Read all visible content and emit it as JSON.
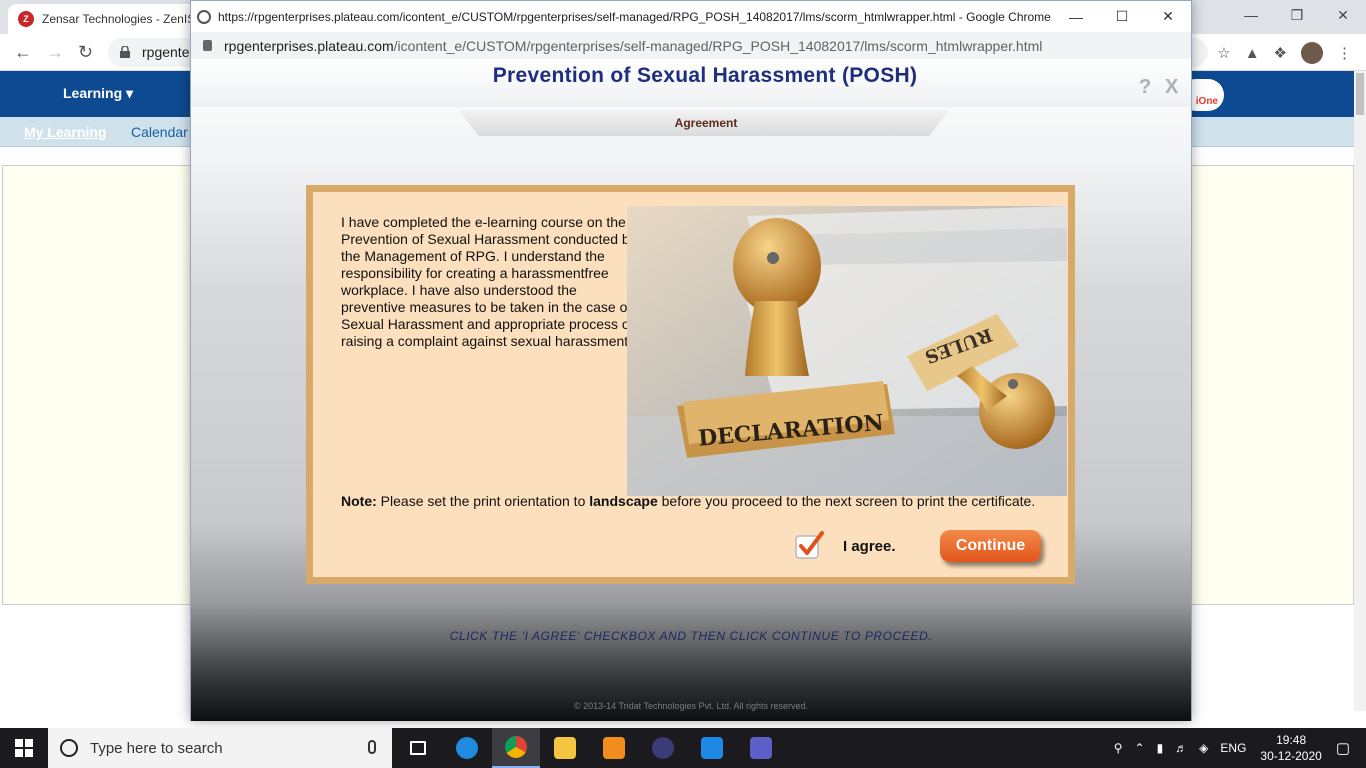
{
  "browser": {
    "tab_title": "Zensar Technologies - ZenIS",
    "tab_favicon_text": "Z",
    "address_partial": "rpgente",
    "learning_menu": "Learning",
    "logo_text": "iOne",
    "subnav": {
      "my_learning": "My Learning",
      "calendar": "Calendar"
    }
  },
  "popup": {
    "title": "https://rpgenterprises.plateau.com/icontent_e/CUSTOM/rpgenterprises/self-managed/RPG_POSH_14082017/lms/scorm_htmlwrapper.html - Google Chrome",
    "url_domain": "rpgenterprises.plateau.com",
    "url_path": "/icontent_e/CUSTOM/rpgenterprises/self-managed/RPG_POSH_14082017/lms/scorm_htmlwrapper.html"
  },
  "course": {
    "title": "Prevention of Sexual Harassment (POSH)",
    "help_glyph": "?",
    "close_glyph": "X",
    "section_tab": "Agreement",
    "agreement_text": "I have completed the e-learning course on the Prevention of Sexual Harassment conducted by the Management of RPG. I understand the responsibility for creating a harassmentfree workplace. I have also understood the preventive measures to be taken in the case of Sexual Harassment and appropriate process of raising a complaint against sexual harassment.",
    "note_label": "Note:",
    "note_text_1": "Please set the print orientation to",
    "note_bold": "landscape",
    "note_text_2": "before you proceed to the next screen to print the certificate.",
    "stamp_declaration": "DECLARATION",
    "stamp_rules": "RULES",
    "agree_label": "I agree.",
    "agree_checked": true,
    "continue_label": "Continue",
    "instruction": "CLICK THE 'I AGREE' CHECKBOX AND THEN CLICK CONTINUE TO PROCEED.",
    "copyright": "© 2013-14 Tridat Technologies Pvt. Ltd. All rights reserved."
  },
  "taskbar": {
    "search_placeholder": "Type here to search",
    "language": "ENG",
    "time": "19:48",
    "date": "30-12-2020"
  },
  "colors": {
    "course_title": "#1f2e7c",
    "continue_button": "#e2551c",
    "panel_border": "#d9a96a",
    "panel_fill": "#fcdfbd",
    "nav_blue": "#0d4a91"
  }
}
